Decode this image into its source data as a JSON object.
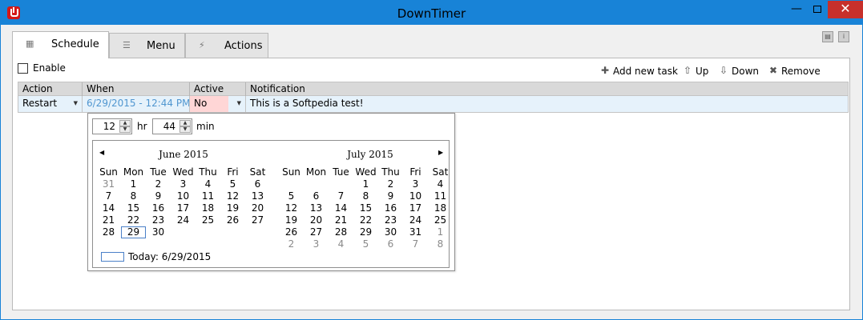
{
  "window": {
    "title": "DownTimer",
    "minimize_glyph": "—",
    "close_glyph": "✕"
  },
  "tabs": [
    {
      "label": "Schedule",
      "icon": "calendar-icon",
      "active": true
    },
    {
      "label": "Menu",
      "icon": "list-icon",
      "active": false
    },
    {
      "label": "Actions",
      "icon": "lightning-icon",
      "active": false
    }
  ],
  "schedule": {
    "enable_label": "Enable",
    "enabled": false,
    "toolbar": {
      "add_label": "Add new task",
      "up_label": "Up",
      "down_label": "Down",
      "remove_label": "Remove"
    },
    "grid": {
      "columns": [
        "Action",
        "When",
        "Active",
        "Notification"
      ],
      "rows": [
        {
          "action": "Restart",
          "when": "6/29/2015 - 12:44 PM",
          "active": "No",
          "notification": "This is a Softpedia test!"
        }
      ]
    }
  },
  "datetime_popup": {
    "hour": "12",
    "hour_label": "hr",
    "minute": "44",
    "minute_label": "min",
    "weekdays": [
      "Sun",
      "Mon",
      "Tue",
      "Wed",
      "Thu",
      "Fri",
      "Sat"
    ],
    "months": [
      {
        "title": "June 2015",
        "weeks": [
          [
            "31",
            "1",
            "2",
            "3",
            "4",
            "5",
            "6"
          ],
          [
            "7",
            "8",
            "9",
            "10",
            "11",
            "12",
            "13"
          ],
          [
            "14",
            "15",
            "16",
            "17",
            "18",
            "19",
            "20"
          ],
          [
            "21",
            "22",
            "23",
            "24",
            "25",
            "26",
            "27"
          ],
          [
            "28",
            "29",
            "30",
            "",
            "",
            "",
            ""
          ]
        ],
        "other_month_days": [
          "0-0"
        ],
        "selected": "4-1"
      },
      {
        "title": "July 2015",
        "weeks": [
          [
            "",
            "",
            "",
            "1",
            "2",
            "3",
            "4"
          ],
          [
            "5",
            "6",
            "7",
            "8",
            "9",
            "10",
            "11"
          ],
          [
            "12",
            "13",
            "14",
            "15",
            "16",
            "17",
            "18"
          ],
          [
            "19",
            "20",
            "21",
            "22",
            "23",
            "24",
            "25"
          ],
          [
            "26",
            "27",
            "28",
            "29",
            "30",
            "31",
            "1"
          ],
          [
            "2",
            "3",
            "4",
            "5",
            "6",
            "7",
            "8"
          ]
        ],
        "other_month_days": [
          "4-6",
          "5-0",
          "5-1",
          "5-2",
          "5-3",
          "5-4",
          "5-5",
          "5-6"
        ],
        "selected": ""
      }
    ],
    "today_label": "Today: 6/29/2015",
    "prev_glyph": "◀",
    "next_glyph": "▶"
  },
  "colors": {
    "titlebar": "#1883d7",
    "close_button": "#c7302b",
    "selected_row": "#e6f2fb",
    "inactive_cell": "#ffd6d6",
    "link_text": "#5096d0"
  }
}
